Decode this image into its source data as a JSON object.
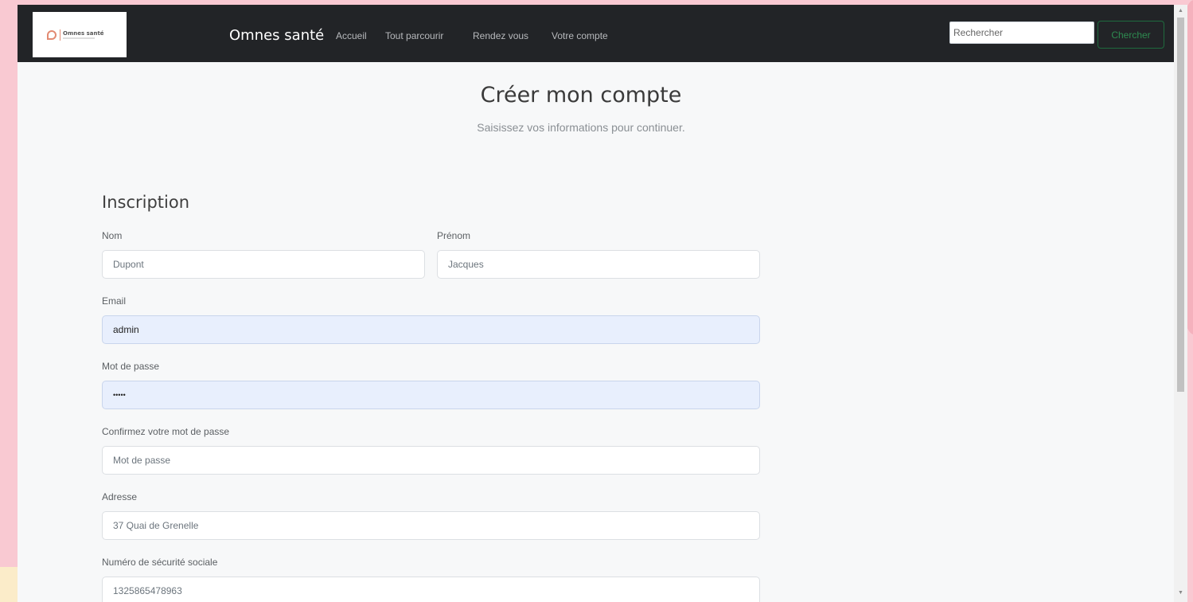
{
  "colors": {
    "navbar": "#222427",
    "accent_green": "#2e8b50",
    "page_bg": "#f7f8f9",
    "autofill_bg": "#e8effd",
    "backdrop": "#f9c9d2"
  },
  "navbar": {
    "logo_text": "Omnes santé",
    "brand": "Omnes santé",
    "links": [
      "Accueil",
      "Tout parcourir",
      "Rendez vous",
      "Votre compte"
    ],
    "search_placeholder": "Rechercher",
    "search_button": "Chercher"
  },
  "header": {
    "title": "Créer mon compte",
    "subtitle": "Saisissez vos informations pour continuer."
  },
  "form": {
    "section_title": "Inscription",
    "fields": {
      "nom": {
        "label": "Nom",
        "placeholder": "Dupont",
        "value": ""
      },
      "prenom": {
        "label": "Prénom",
        "placeholder": "Jacques",
        "value": ""
      },
      "email": {
        "label": "Email",
        "value": "admin"
      },
      "password": {
        "label": "Mot de passe",
        "value": "•••••"
      },
      "confirm": {
        "label": "Confirmez votre mot de passe",
        "placeholder": "Mot de passe",
        "value": ""
      },
      "adresse": {
        "label": "Adresse",
        "placeholder": "37 Quai de Grenelle",
        "value": ""
      },
      "secu": {
        "label": "Numéro de sécurité sociale",
        "placeholder": "1325865478963",
        "value": ""
      }
    }
  },
  "scrollbar": {
    "up_icon": "▲",
    "down_icon": "▼"
  }
}
